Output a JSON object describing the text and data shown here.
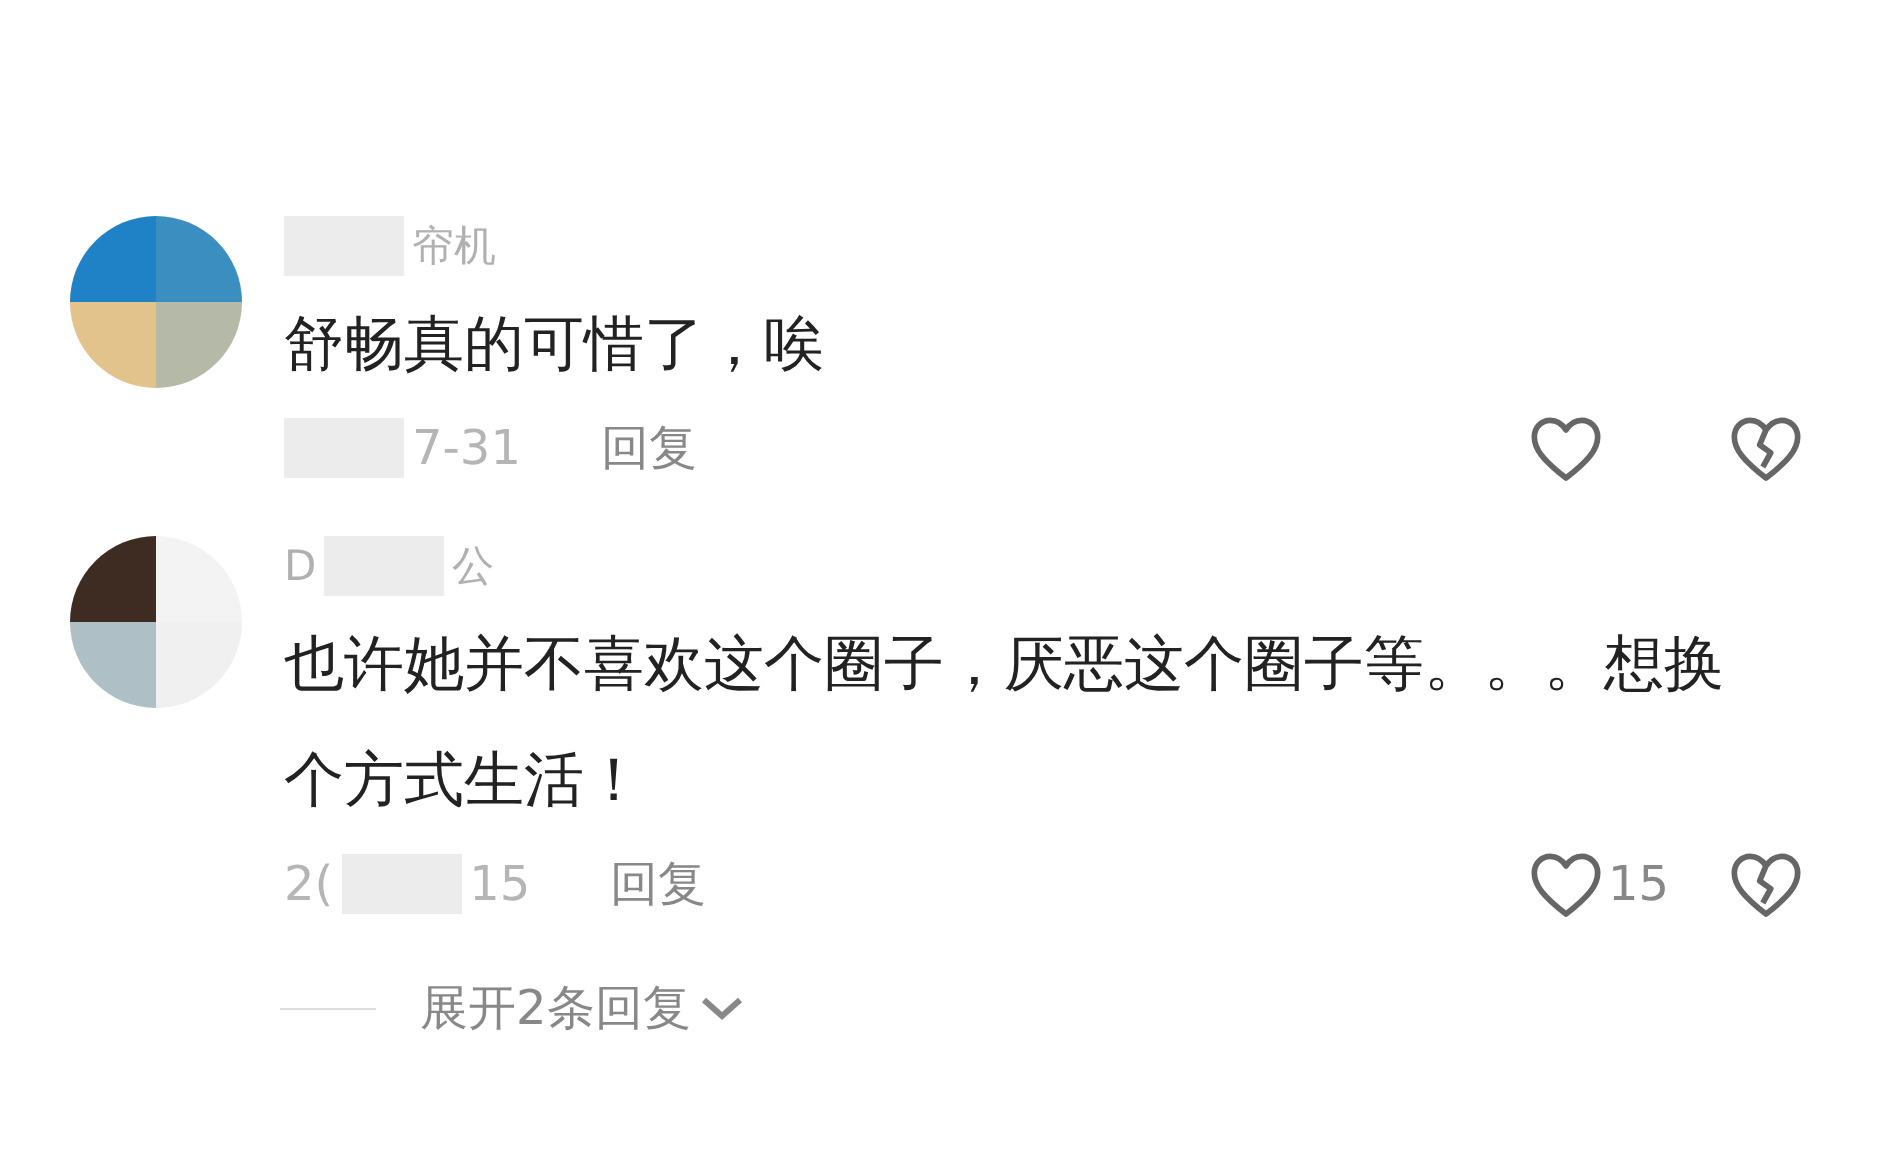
{
  "comments": [
    {
      "name": [
        {
          "kind": "redacted"
        },
        {
          "kind": "text",
          "text": "帘机"
        }
      ],
      "content": "舒畅真的可惜了，唉",
      "date": [
        {
          "kind": "redacted"
        },
        {
          "kind": "text",
          "text": "7-31"
        }
      ],
      "reply": "回复",
      "liked": false,
      "disliked": false
    },
    {
      "name": [
        {
          "kind": "text",
          "text": "D"
        },
        {
          "kind": "redacted"
        },
        {
          "kind": "text",
          "text": "公"
        }
      ],
      "content": "也许她并不喜欢这个圈子，厌恶这个圈子等。。。想换个方式生活！",
      "date": [
        {
          "kind": "text",
          "text": "2("
        },
        {
          "kind": "redacted"
        },
        {
          "kind": "text",
          "text": "15"
        }
      ],
      "reply": "回复",
      "liked": false,
      "like_count": "15",
      "disliked": false,
      "expand_replies": "展开2条回复"
    }
  ]
}
